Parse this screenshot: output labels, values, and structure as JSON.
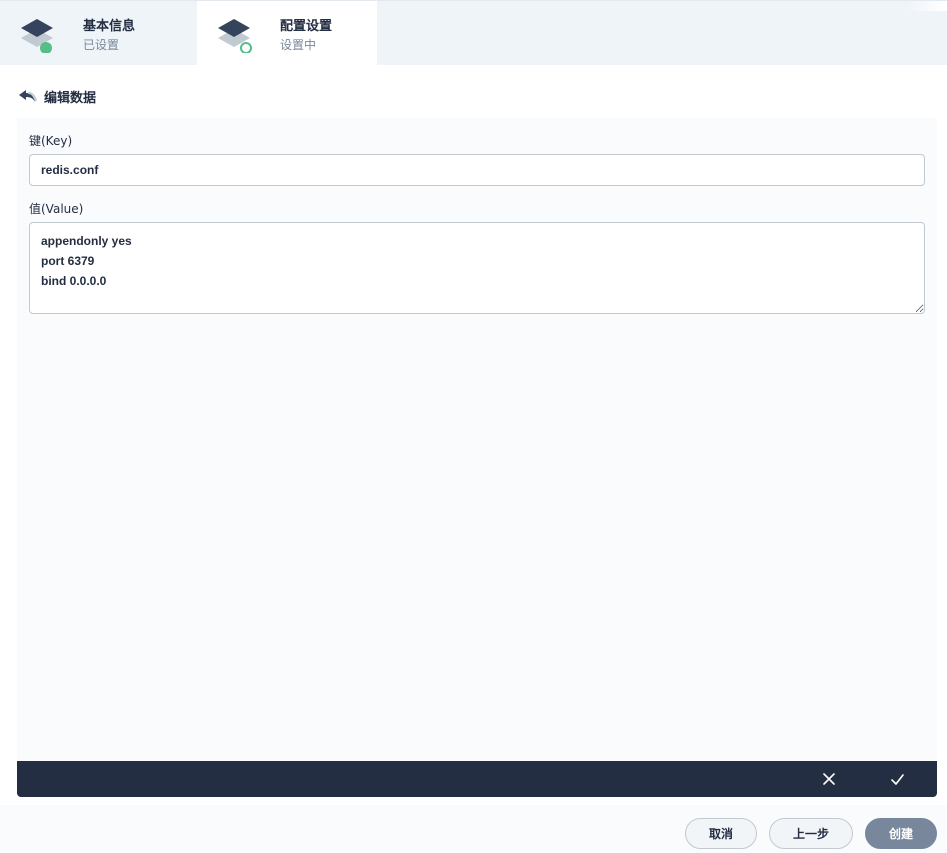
{
  "steps": [
    {
      "title": "基本信息",
      "status": "已设置",
      "state": "done"
    },
    {
      "title": "配置设置",
      "status": "设置中",
      "state": "active"
    }
  ],
  "editor": {
    "title": "编辑数据",
    "key_label": "键(Key)",
    "key_value": "redis.conf",
    "value_label": "值(Value)",
    "value_text": "appendonly yes\nport 6379\nbind 0.0.0.0"
  },
  "footer": {
    "cancel": "取消",
    "prev": "上一步",
    "create": "创建"
  },
  "colors": {
    "dark": "#242e42",
    "success": "#55bc8a",
    "muted": "#79879c"
  }
}
